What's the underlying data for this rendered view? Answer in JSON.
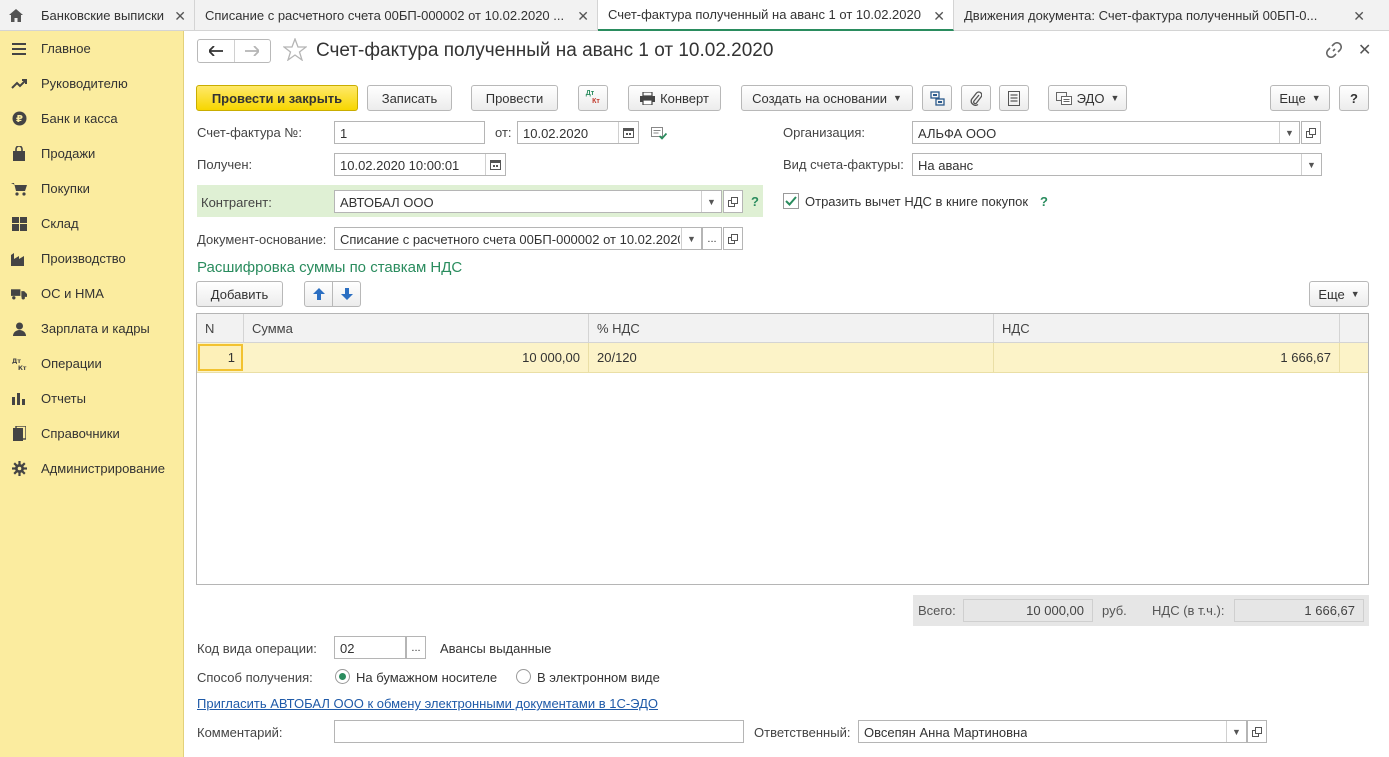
{
  "tabs": [
    {
      "label": "Банковские выписки",
      "active": false
    },
    {
      "label": "Списание с расчетного счета 00БП-000002 от 10.02.2020 ...",
      "active": false
    },
    {
      "label": "Счет-фактура полученный на аванс 1 от 10.02.2020",
      "active": true
    },
    {
      "label": "Движения документа: Счет-фактура полученный 00БП-0...",
      "active": false
    }
  ],
  "sidebar": {
    "items": [
      {
        "label": "Главное",
        "icon": "menu-icon"
      },
      {
        "label": "Руководителю",
        "icon": "trend-icon"
      },
      {
        "label": "Банк и касса",
        "icon": "ruble-icon"
      },
      {
        "label": "Продажи",
        "icon": "bag-icon"
      },
      {
        "label": "Покупки",
        "icon": "cart-icon"
      },
      {
        "label": "Склад",
        "icon": "warehouse-icon"
      },
      {
        "label": "Производство",
        "icon": "factory-icon"
      },
      {
        "label": "ОС и НМА",
        "icon": "truck-icon"
      },
      {
        "label": "Зарплата и кадры",
        "icon": "person-icon"
      },
      {
        "label": "Операции",
        "icon": "dt-kt-icon"
      },
      {
        "label": "Отчеты",
        "icon": "bar-chart-icon"
      },
      {
        "label": "Справочники",
        "icon": "book-icon"
      },
      {
        "label": "Администрирование",
        "icon": "gear-icon"
      }
    ]
  },
  "header": {
    "title": "Счет-фактура полученный на аванс 1 от 10.02.2020"
  },
  "toolbar": {
    "post_close": "Провести и закрыть",
    "save": "Записать",
    "post": "Провести",
    "dt_kt_top": "Дт",
    "dt_kt_bottom": "Кт",
    "envelope": "Конверт",
    "create_based": "Создать на основании",
    "edo": "ЭДО",
    "more": "Еще",
    "help": "?"
  },
  "form": {
    "invoice_no_label": "Счет-фактура №:",
    "invoice_no": "1",
    "from_label": "от:",
    "from_date": "10.02.2020",
    "received_label": "Получен:",
    "received": "10.02.2020 10:00:01",
    "counterparty_label": "Контрагент:",
    "counterparty": "АВТОБАЛ ООО",
    "help_q": "?",
    "base_doc_label": "Документ-основание:",
    "base_doc": "Списание с расчетного счета 00БП-000002 от 10.02.2020",
    "base_doc_dots": "...",
    "org_label": "Организация:",
    "org": "АЛЬФА ООО",
    "invoice_kind_label": "Вид счета-фактуры:",
    "invoice_kind": "На аванс",
    "reflect_vat_label": "Отразить вычет НДС в книге покупок",
    "reflect_vat_checked": true
  },
  "section": {
    "title": "Расшифровка суммы по ставкам НДС",
    "add": "Добавить",
    "more": "Еще"
  },
  "table": {
    "columns": [
      "N",
      "Сумма",
      "% НДС",
      "НДС"
    ],
    "rows": [
      {
        "n": "1",
        "sum": "10 000,00",
        "rate": "20/120",
        "vat": "1 666,67"
      }
    ]
  },
  "totals": {
    "total_label": "Всего:",
    "total": "10 000,00",
    "currency": "руб.",
    "vat_label": "НДС (в т.ч.):",
    "vat": "1 666,67"
  },
  "bottom": {
    "op_code_label": "Код вида операции:",
    "op_code": "02",
    "op_code_dots": "...",
    "op_code_desc": "Авансы выданные",
    "receipt_label": "Способ получения:",
    "receipt_paper": "На бумажном носителе",
    "receipt_electronic": "В электронном виде",
    "receipt_selected": "paper",
    "invite_link": "Пригласить АВТОБАЛ ООО к обмену электронными документами в 1С-ЭДО",
    "comment_label": "Комментарий:",
    "comment": "",
    "responsible_label": "Ответственный:",
    "responsible": "Овсепян Анна Мартиновна"
  },
  "colors": {
    "accent_green": "#2a8c5e",
    "sidebar_bg": "#fbec9f",
    "primary_button": "#f7d600",
    "row_highlight": "#fcf3c8"
  }
}
